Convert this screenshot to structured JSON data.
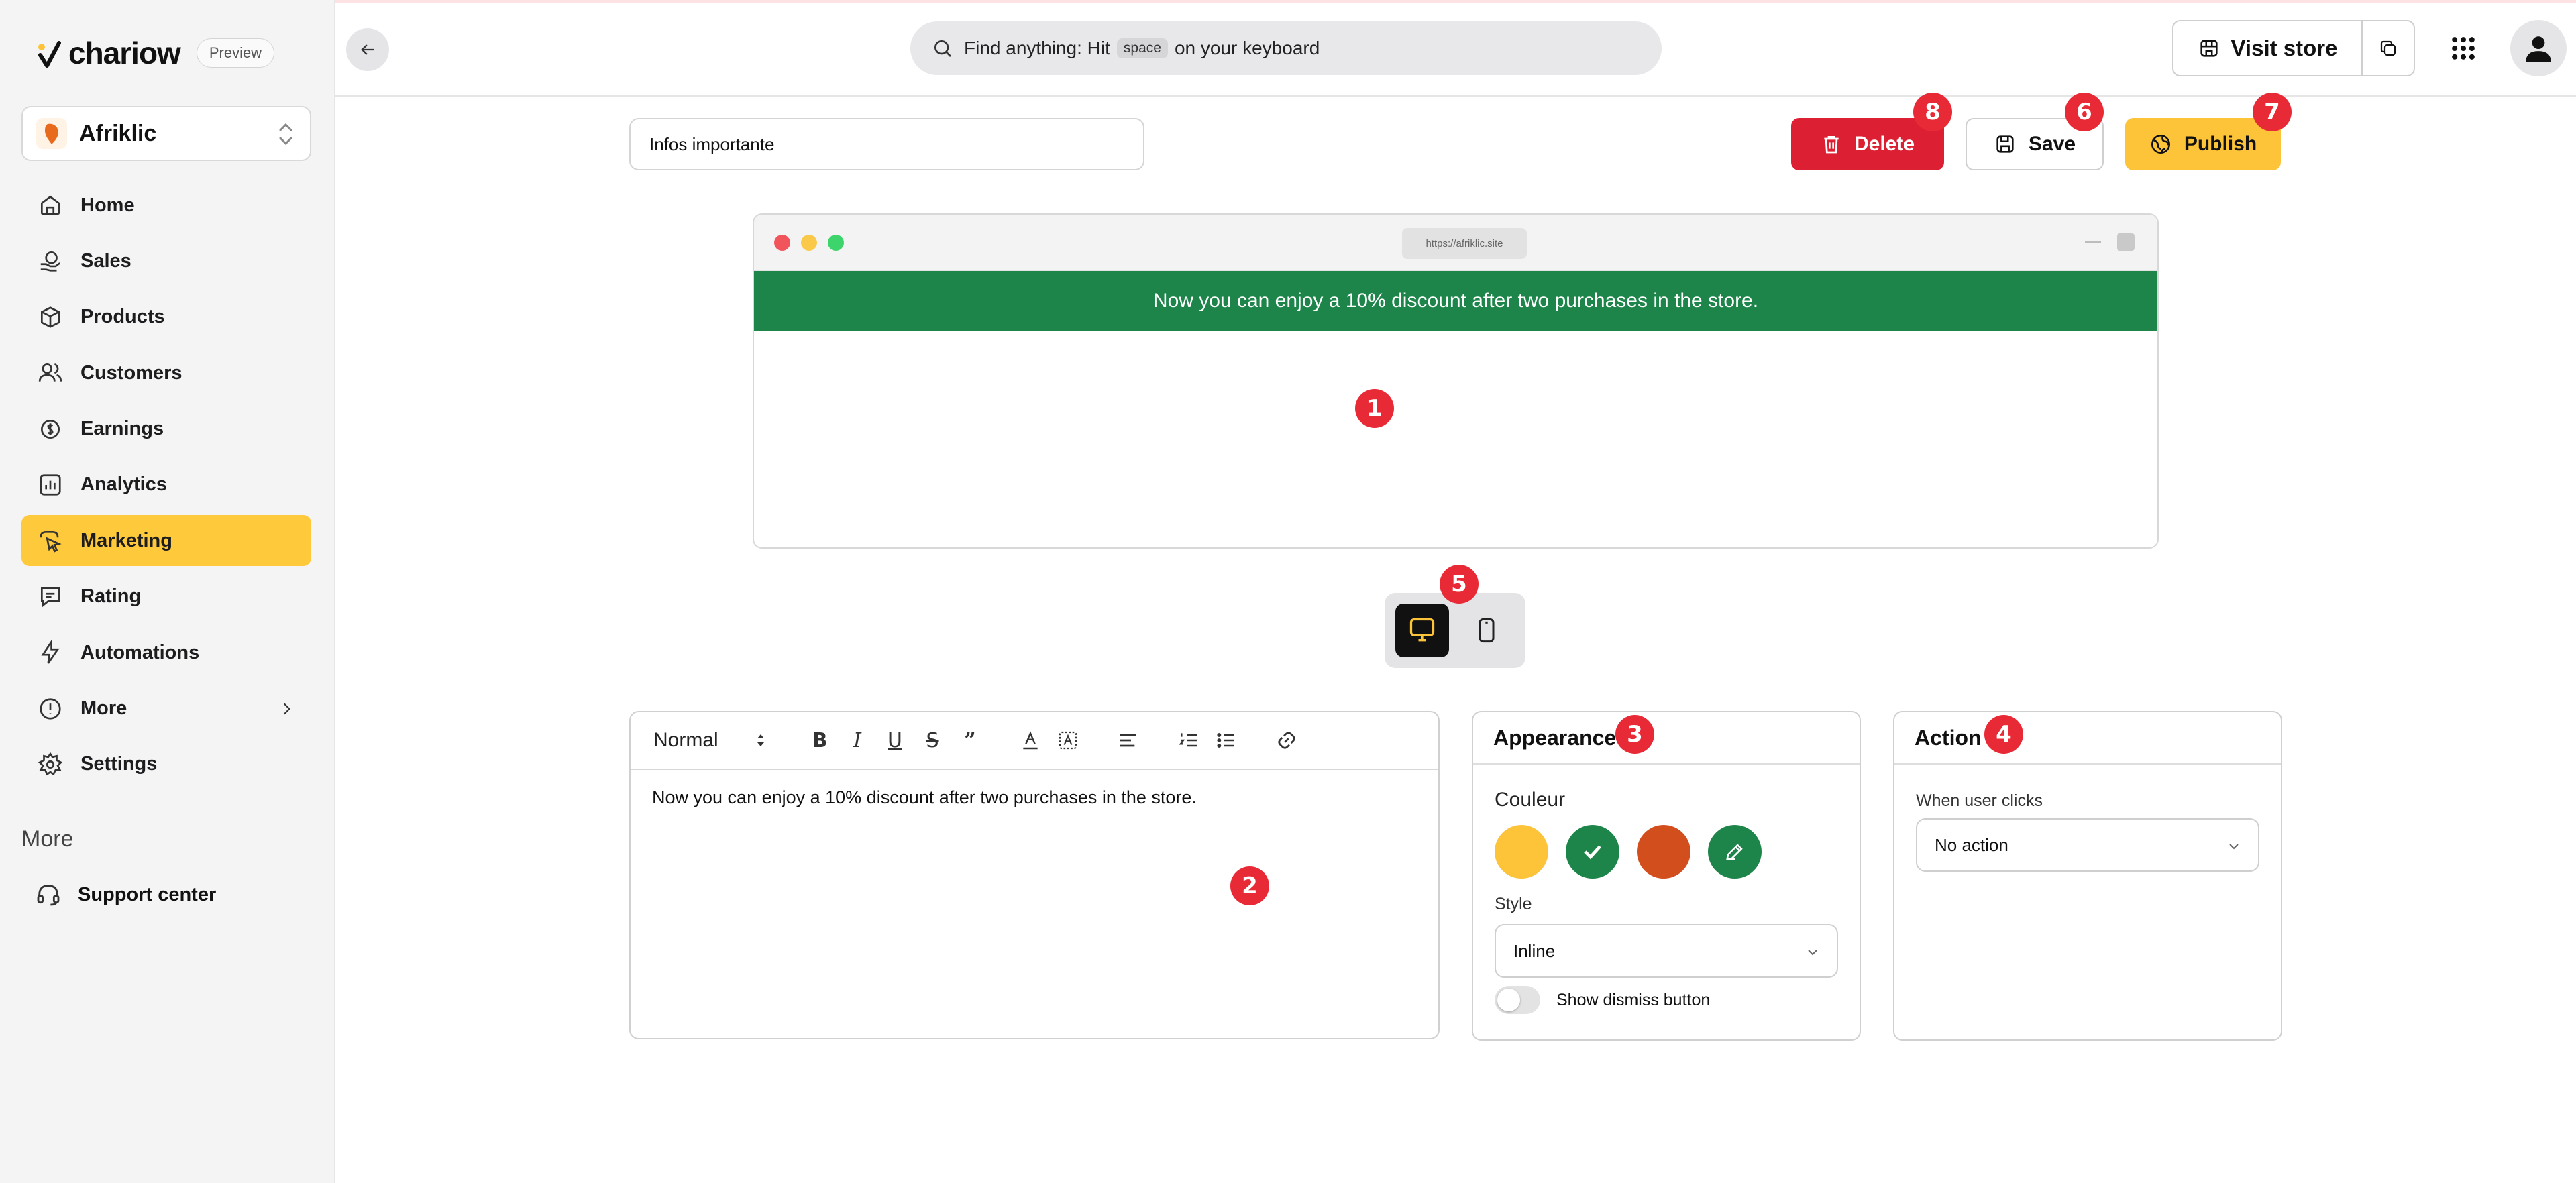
{
  "brand": {
    "logo_text": "chariow",
    "badge": "Preview"
  },
  "store": {
    "name": "Afriklic"
  },
  "nav": {
    "items": [
      {
        "label": "Home"
      },
      {
        "label": "Sales"
      },
      {
        "label": "Products"
      },
      {
        "label": "Customers"
      },
      {
        "label": "Earnings"
      },
      {
        "label": "Analytics"
      },
      {
        "label": "Marketing",
        "active": true
      },
      {
        "label": "Rating"
      },
      {
        "label": "Automations"
      },
      {
        "label": "More"
      },
      {
        "label": "Settings"
      }
    ],
    "section_heading": "More",
    "support_label": "Support center"
  },
  "header": {
    "search_prefix": "Find anything: Hit",
    "search_key": "space",
    "search_suffix": "on your keyboard",
    "visit_store_label": "Visit store"
  },
  "toolbar": {
    "title_value": "Infos importante",
    "delete_label": "Delete",
    "save_label": "Save",
    "publish_label": "Publish"
  },
  "preview": {
    "url": "https://afriklic.site",
    "announcement": "Now you can enjoy a 10% discount after two purchases in the store."
  },
  "editor": {
    "format_select": "Normal",
    "content": "Now you can enjoy a 10% discount after two purchases in the store."
  },
  "appearance": {
    "title": "Appearance",
    "color_label": "Couleur",
    "colors": [
      "#fdc43a",
      "#1d844a",
      "#d24e1d",
      "#1d844a"
    ],
    "style_label": "Style",
    "style_value": "Inline",
    "dismiss_label": "Show dismiss button"
  },
  "action": {
    "title": "Action",
    "when_label": "When user clicks",
    "value": "No action"
  },
  "markers": [
    "1",
    "2",
    "3",
    "4",
    "5",
    "6",
    "7",
    "8"
  ]
}
